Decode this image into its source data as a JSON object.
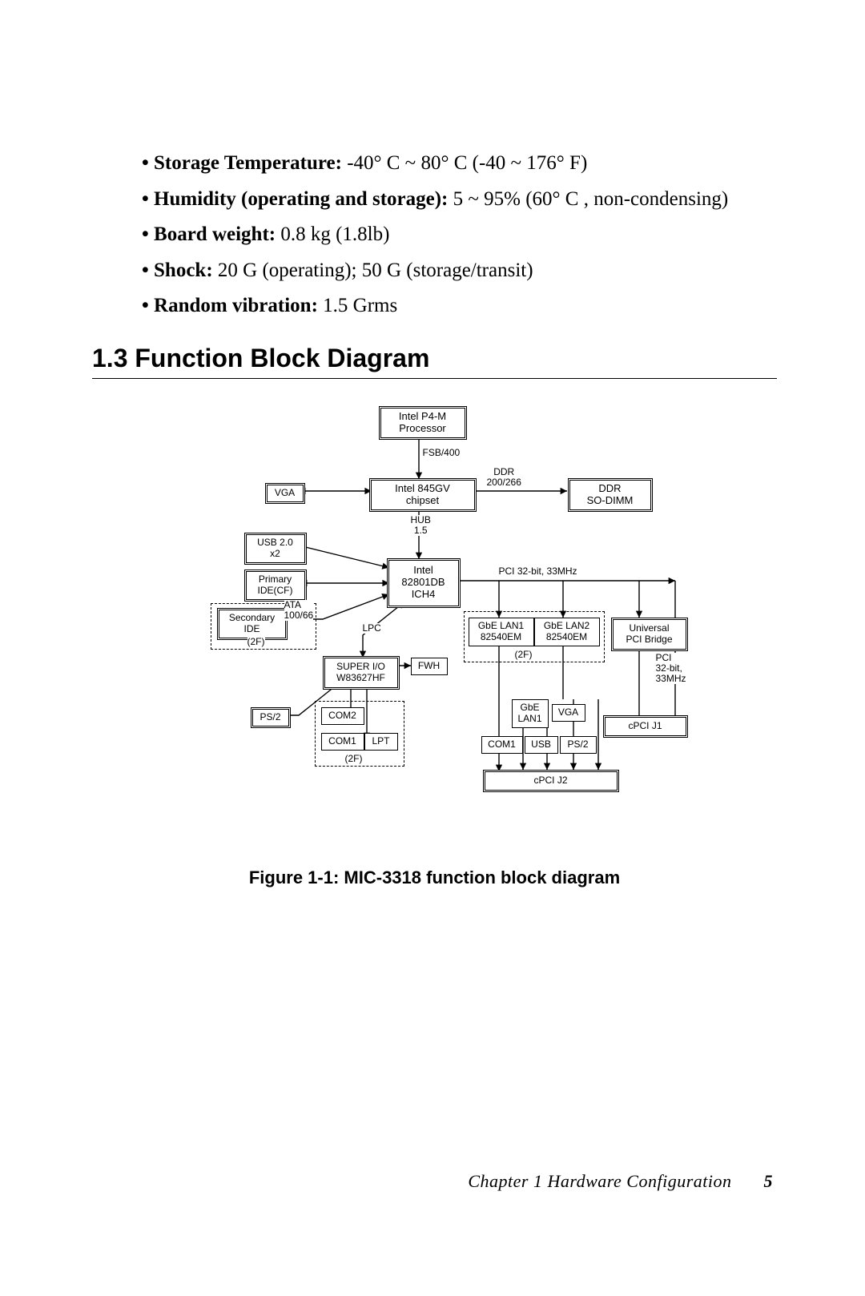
{
  "specs": [
    {
      "label": "Storage Temperature:",
      "value": " -40° C ~ 80° C (-40 ~ 176° F)"
    },
    {
      "label": "Humidity (operating and storage):",
      "value": " 5 ~ 95% (60° C , non-condensing)"
    },
    {
      "label": "Board weight:",
      "value": " 0.8 kg (1.8lb)"
    },
    {
      "label": "Shock:",
      "value": " 20 G (operating); 50 G (storage/transit)"
    },
    {
      "label": "Random vibration:",
      "value": " 1.5 Grms"
    }
  ],
  "section": {
    "number": "1.3",
    "title": "Function Block Diagram"
  },
  "figure": {
    "caption": "Figure 1-1: MIC-3318 function block diagram"
  },
  "footer": {
    "text": "Chapter 1  Hardware Configuration",
    "page": "5"
  },
  "diagram": {
    "cpu": "Intel P4-M\nProcessor",
    "fsb": "FSB/400",
    "n845": "Intel 845GV\nchipset",
    "vga": "VGA",
    "ddr_lbl": "DDR\n200/266",
    "ddr": "DDR\nSO-DIMM",
    "hub": "HUB\n1.5",
    "usb20": "USB 2.0\nx2",
    "primary_ide": "Primary\nIDE(CF)",
    "ich4": "Intel\n82801DB\nICH4",
    "pci_lbl": "PCI 32-bit, 33MHz",
    "ata": "ATA\n100/66",
    "secondary_ide": "Secondary\nIDE",
    "sec_2f": "(2F)",
    "lpc": "LPC",
    "superio": "SUPER I/O\nW83627HF",
    "fwh": "FWH",
    "lan1": "GbE LAN1\n82540EM",
    "lan2": "GbE LAN2\n82540EM",
    "universal": "Universal\nPCI Bridge",
    "lan2f": "(2F)",
    "pci_side": "PCI\n32-bit,\n33MHz",
    "cpci_j1": "cPCI J1",
    "ps2_left": "PS/2",
    "com2": "COM2",
    "com1_left": "COM1",
    "lpt": "LPT",
    "io2f": "(2F)",
    "gbe_lan1": "GbE\nLAN1",
    "vga_low": "VGA",
    "com1_low": "COM1",
    "usb_low": "USB",
    "ps2_low": "PS/2",
    "cpci_j2": "cPCI J2"
  }
}
